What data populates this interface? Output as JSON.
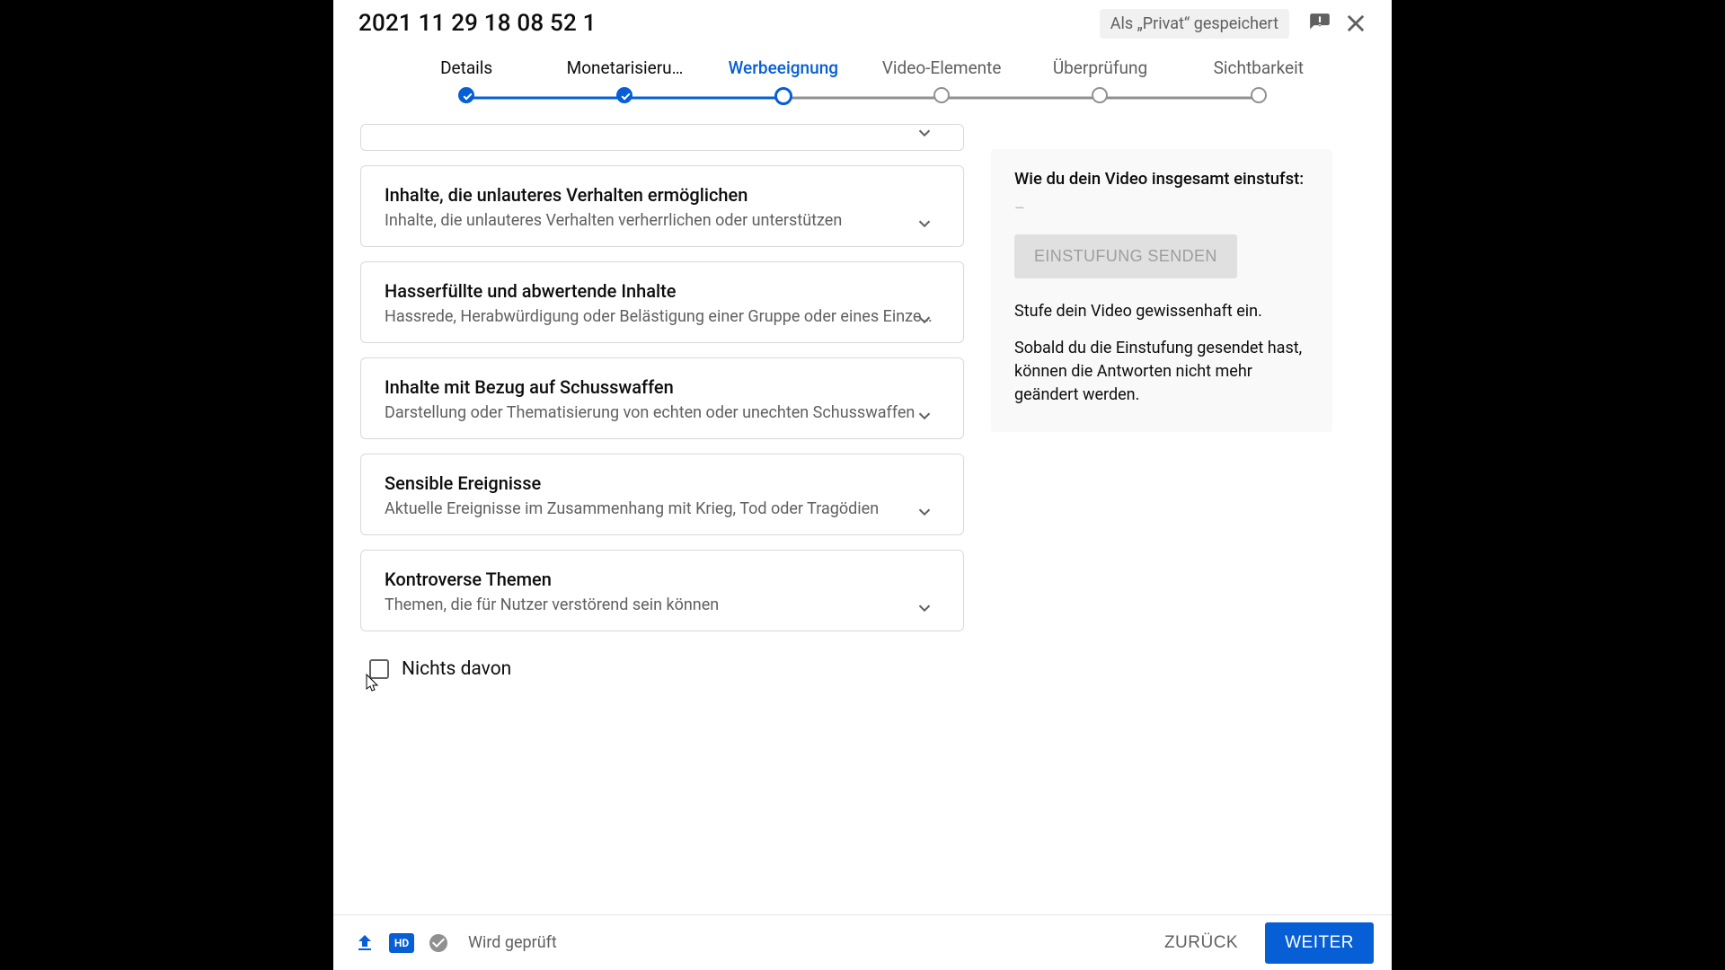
{
  "header": {
    "title": "2021 11 29 18 08 52 1",
    "saved_status": "Als „Privat“ gespeichert"
  },
  "stepper": {
    "steps": [
      {
        "label": "Details",
        "state": "done"
      },
      {
        "label": "Monetarisieru…",
        "state": "done"
      },
      {
        "label": "Werbeeignung",
        "state": "active"
      },
      {
        "label": "Video-Elemente",
        "state": "pending"
      },
      {
        "label": "Überprüfung",
        "state": "pending"
      },
      {
        "label": "Sichtbarkeit",
        "state": "pending"
      }
    ]
  },
  "questions": [
    {
      "title": "Inhalte, die unlauteres Verhalten ermöglichen",
      "desc": "Inhalte, die unlauteres Verhalten verherrlichen oder unterstützen"
    },
    {
      "title": "Hasserfüllte und abwertende Inhalte",
      "desc": "Hassrede, Herabwürdigung oder Belästigung einer Gruppe oder eines Einze…"
    },
    {
      "title": "Inhalte mit Bezug auf Schusswaffen",
      "desc": "Darstellung oder Thematisierung von echten oder unechten Schusswaffen"
    },
    {
      "title": "Sensible Ereignisse",
      "desc": "Aktuelle Ereignisse im Zusammenhang mit Krieg, Tod oder Tragödien"
    },
    {
      "title": "Kontroverse Themen",
      "desc": "Themen, die für Nutzer verstörend sein können"
    }
  ],
  "none_label": "Nichts davon",
  "panel": {
    "heading": "Wie du dein Video insgesamt einstufst:",
    "value": "–",
    "button": "EINSTUFUNG SENDEN",
    "hint": "Stufe dein Video gewissenhaft ein.",
    "note": "Sobald du die Einstufung gesendet hast, können die Antworten nicht mehr geändert werden."
  },
  "footer": {
    "hd": "HD",
    "status": "Wird geprüft",
    "back": "ZURÜCK",
    "next": "WEITER"
  }
}
